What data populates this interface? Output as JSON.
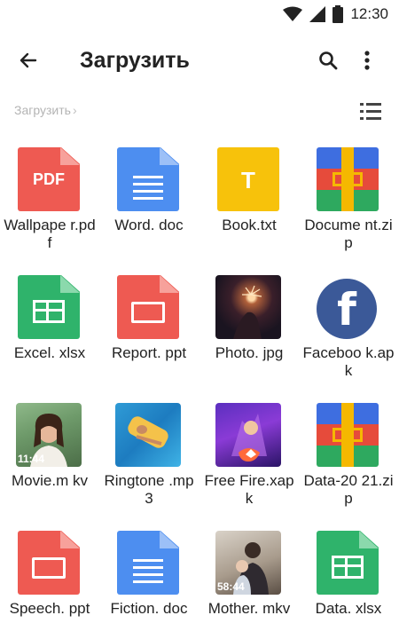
{
  "status": {
    "time": "12:30"
  },
  "appbar": {
    "title": "Загрузить"
  },
  "breadcrumb": {
    "path": "Загрузить"
  },
  "colors": {
    "red": "#ee5a52",
    "blue": "#4d8ef0",
    "green": "#2fb36b",
    "yellow": "#f7c20b",
    "facebook": "#3b5998"
  },
  "files": [
    {
      "name": "Wallpaper.pdf",
      "label": "Wallpape r.pdf",
      "icon": "pdf-icon",
      "glyph": "PDF"
    },
    {
      "name": "Word.doc",
      "label": "Word. doc",
      "icon": "doc-icon"
    },
    {
      "name": "Book.txt",
      "label": "Book.txt",
      "icon": "txt-icon",
      "glyph": "T"
    },
    {
      "name": "Document.zip",
      "label": "Docume nt.zip",
      "icon": "zip-icon"
    },
    {
      "name": "Excel.xlsx",
      "label": "Excel. xlsx",
      "icon": "xlsx-icon"
    },
    {
      "name": "Report.ppt",
      "label": "Report. ppt",
      "icon": "ppt-icon"
    },
    {
      "name": "Photo.jpg",
      "label": "Photo. jpg",
      "icon": "photo-thumbnail"
    },
    {
      "name": "Facebook.apk",
      "label": "Faceboo k.apk",
      "icon": "facebook-icon",
      "glyph": "f"
    },
    {
      "name": "Movie.mkv",
      "label": "Movie.m kv",
      "icon": "video-thumbnail",
      "duration": "11:44"
    },
    {
      "name": "Ringtone.mp3",
      "label": "Ringtone .mp3",
      "icon": "audio-thumbnail"
    },
    {
      "name": "Free Fire.xapk",
      "label": "Free Fire.xapk",
      "icon": "game-thumbnail"
    },
    {
      "name": "Data-2021.zip",
      "label": "Data-20 21.zip",
      "icon": "zip-icon"
    },
    {
      "name": "Speech.ppt",
      "label": "Speech. ppt",
      "icon": "ppt-icon"
    },
    {
      "name": "Fiction.doc",
      "label": "Fiction. doc",
      "icon": "doc-icon"
    },
    {
      "name": "Mother.mkv",
      "label": "Mother. mkv",
      "icon": "video-thumbnail",
      "duration": "58:44"
    },
    {
      "name": "Data.xlsx",
      "label": "Data. xlsx",
      "icon": "xlsx-icon"
    }
  ]
}
